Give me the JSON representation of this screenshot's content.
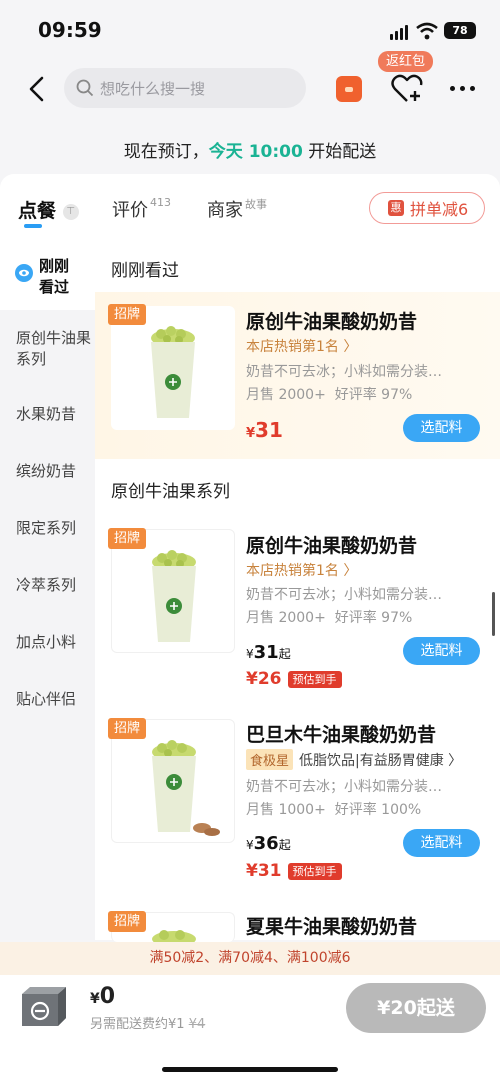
{
  "status": {
    "time": "09:59",
    "battery": "78"
  },
  "search": {
    "placeholder": "想吃什么搜一搜"
  },
  "header": {
    "red_packet_tip": "返红包"
  },
  "notice": {
    "prefix": "现在预订，",
    "highlight": "今天 10:00",
    "suffix": " 开始配送"
  },
  "tabs": [
    {
      "label": "点餐",
      "sup": "",
      "active": true
    },
    {
      "label": "评价",
      "sup": "413",
      "active": false
    },
    {
      "label": "商家",
      "sup": "故事",
      "active": false
    }
  ],
  "pin_promo": {
    "badge": "惠",
    "label": "拼单减6"
  },
  "sidebar": [
    {
      "label": "刚刚看过"
    },
    {
      "label": "原创牛油果系列"
    },
    {
      "label": "水果奶昔"
    },
    {
      "label": "缤纷奶昔"
    },
    {
      "label": "限定系列"
    },
    {
      "label": "冷萃系列"
    },
    {
      "label": "加点小料"
    },
    {
      "label": "贴心伴侣"
    }
  ],
  "sections": {
    "recent": "刚刚看过",
    "series": "原创牛油果系列"
  },
  "products": [
    {
      "badge": "招牌",
      "name": "原创牛油果酸奶奶昔",
      "rank": "本店热销第1名 〉",
      "desc": "奶昔不可去冰；小料如需分装…",
      "sales": "月售 2000+",
      "rating": "好评率 97%",
      "price_symbol": "¥",
      "price": "31",
      "button": "选配料"
    },
    {
      "badge": "招牌",
      "name": "原创牛油果酸奶奶昔",
      "rank": "本店热销第1名 〉",
      "desc": "奶昔不可去冰；小料如需分装…",
      "sales": "月售 2000+",
      "rating": "好评率 97%",
      "price_symbol": "¥",
      "price": "31",
      "price_suffix": "起",
      "discount_price": "¥26",
      "discount_label": "预估到手",
      "button": "选配料"
    },
    {
      "badge": "招牌",
      "name": "巴旦木牛油果酸奶奶昔",
      "tag_main": "食极星",
      "tag_text": "低脂饮品|有益肠胃健康 〉",
      "desc": "奶昔不可去冰；小料如需分装…",
      "sales": "月售 1000+",
      "rating": "好评率 100%",
      "price_symbol": "¥",
      "price": "36",
      "price_suffix": "起",
      "discount_price": "¥31",
      "discount_label": "预估到手",
      "button": "选配料"
    },
    {
      "badge": "招牌",
      "name": "夏果牛油果酸奶奶昔"
    }
  ],
  "promo_bar": "满50减2、满70减4、满100减6",
  "cart": {
    "amount_symbol": "¥",
    "amount": "0",
    "fee_text": "另需配送费约¥1",
    "fee_original": "¥4",
    "checkout": "¥20起送"
  },
  "colors": {
    "accent_blue": "#3aa7f5",
    "price_red": "#e03c2c",
    "highlight_green": "#1ab394",
    "badge_orange": "#f28b3c"
  }
}
